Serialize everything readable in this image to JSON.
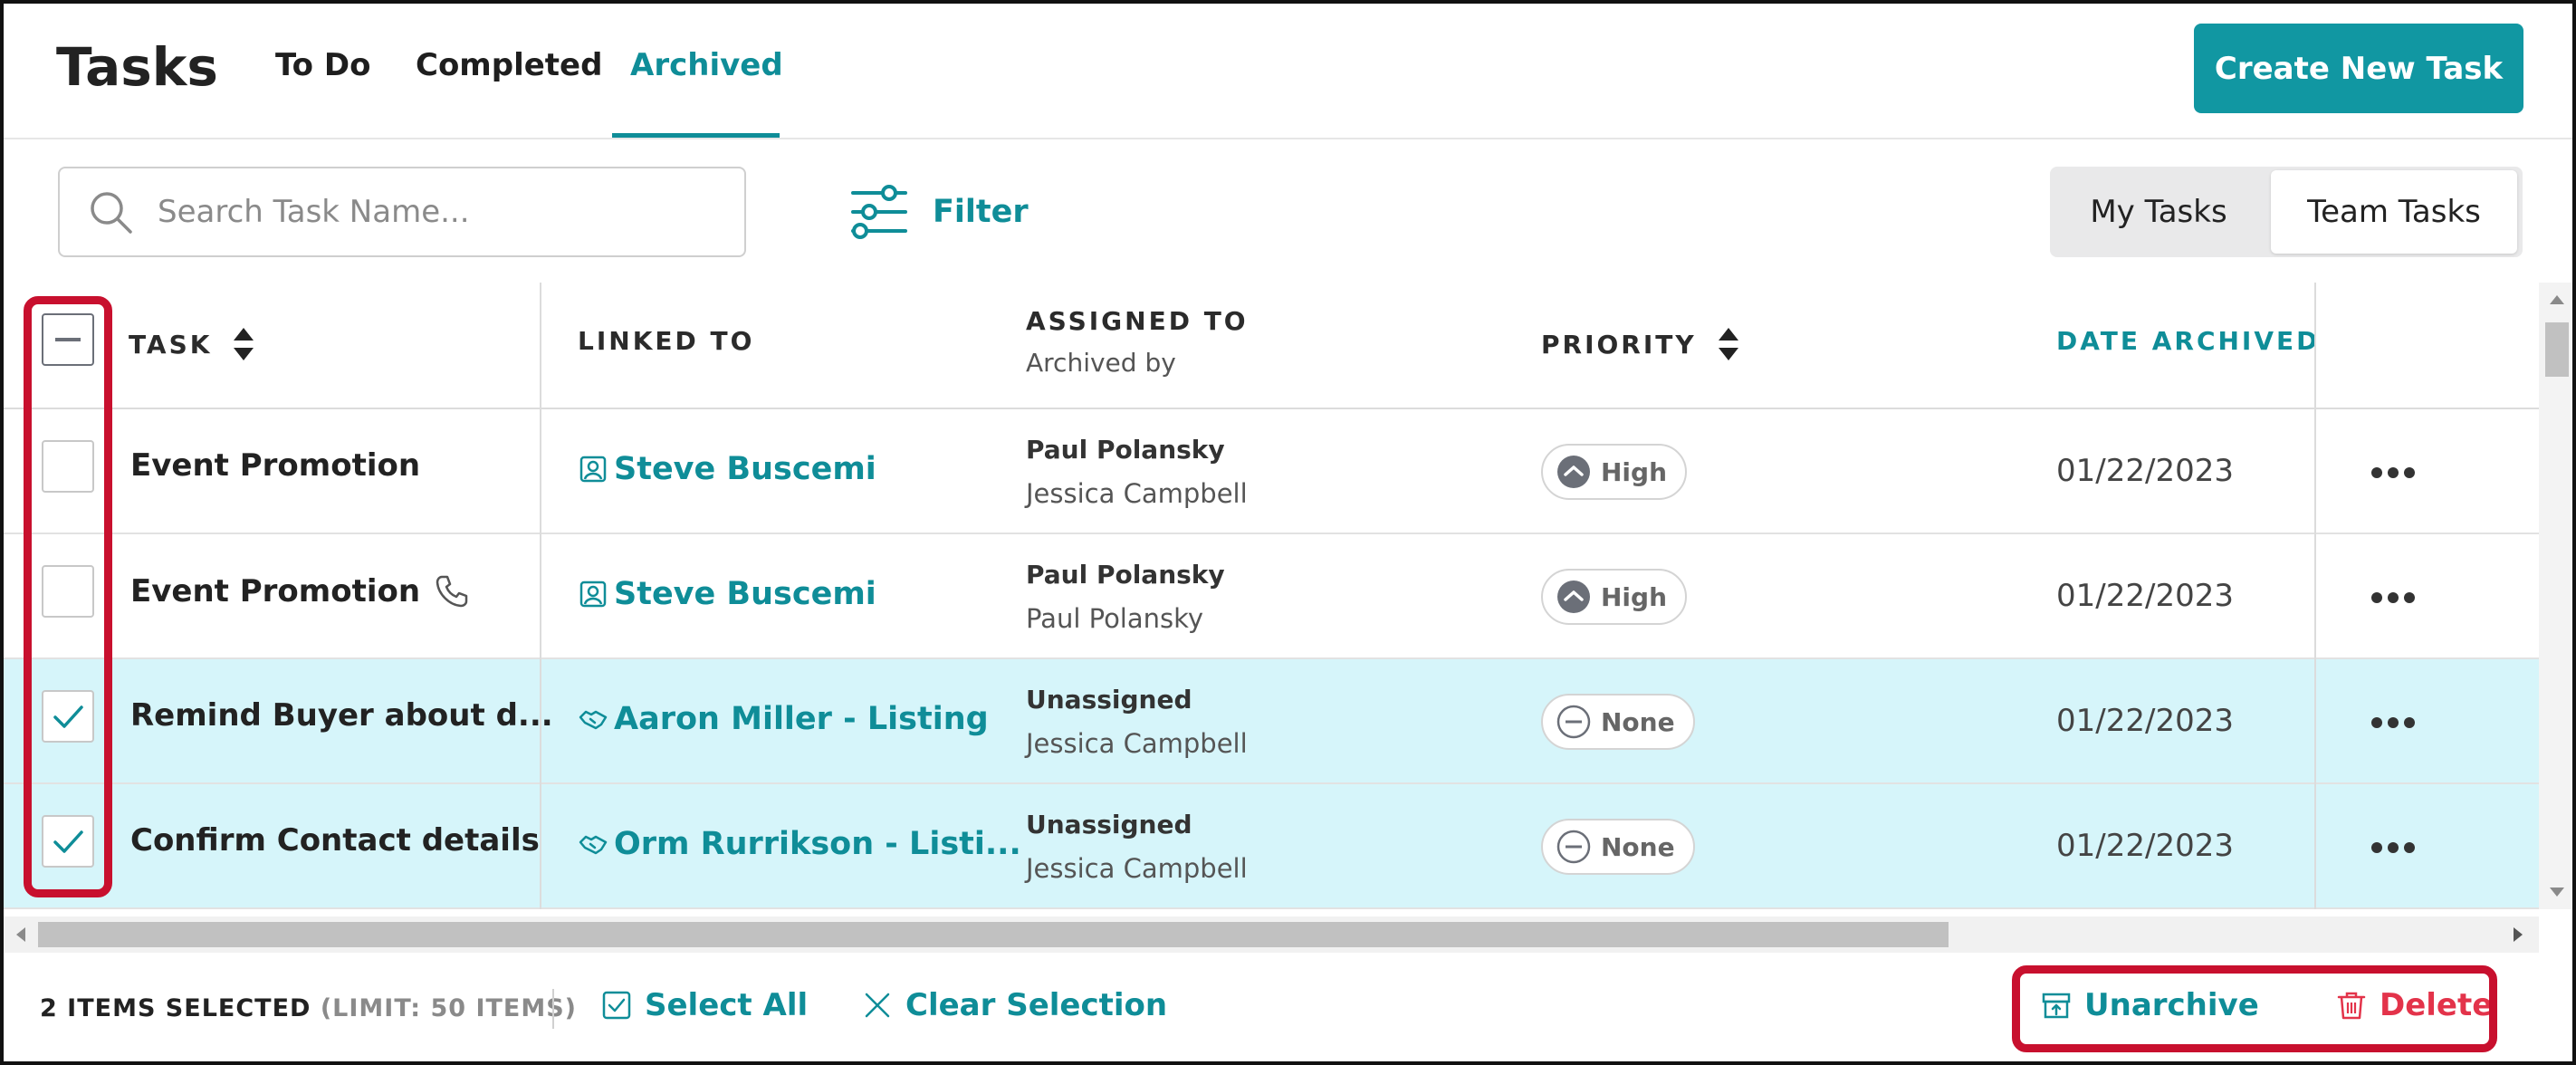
{
  "header": {
    "title": "Tasks",
    "tabs": [
      {
        "label": "To Do"
      },
      {
        "label": "Completed"
      },
      {
        "label": "Archived",
        "active": true
      }
    ],
    "create_button": "Create New Task"
  },
  "toolbar": {
    "search_placeholder": "Search Task Name...",
    "filter_label": "Filter",
    "scope_toggle": {
      "options": [
        "My Tasks",
        "Team Tasks"
      ],
      "selected": "Team Tasks"
    }
  },
  "table": {
    "columns": {
      "task": "TASK",
      "linked_to": "LINKED TO",
      "assigned_to": "ASSIGNED TO",
      "archived_by": "Archived by",
      "priority": "PRIORITY",
      "date_archived": "DATE ARCHIVED"
    },
    "rows": [
      {
        "checked": false,
        "task": "Event Promotion",
        "has_phone_icon": false,
        "linked_icon": "contact-icon",
        "linked_to": "Steve Buscemi",
        "assigned_to": "Paul Polansky",
        "archived_by": "Jessica Campbell",
        "priority": "High",
        "date_archived": "01/22/2023"
      },
      {
        "checked": false,
        "task": "Event Promotion",
        "has_phone_icon": true,
        "linked_icon": "contact-icon",
        "linked_to": "Steve Buscemi",
        "assigned_to": "Paul Polansky",
        "archived_by": "Paul Polansky",
        "priority": "High",
        "date_archived": "01/22/2023"
      },
      {
        "checked": true,
        "task": "Remind Buyer about d...",
        "has_phone_icon": false,
        "linked_icon": "handshake-icon",
        "linked_to": "Aaron Miller - Listing",
        "assigned_to": "Unassigned",
        "archived_by": "Jessica Campbell",
        "priority": "None",
        "date_archived": "01/22/2023"
      },
      {
        "checked": true,
        "task": "Confirm Contact details",
        "has_phone_icon": false,
        "linked_icon": "handshake-icon",
        "linked_to": "Orm Rurrikson - Listi...",
        "assigned_to": "Unassigned",
        "archived_by": "Jessica Campbell",
        "priority": "None",
        "date_archived": "01/22/2023"
      }
    ]
  },
  "footer": {
    "selected_count": "2 ITEMS SELECTED",
    "limit": "(LIMIT: 50 ITEMS)",
    "select_all": "Select All",
    "clear_selection": "Clear Selection",
    "unarchive": "Unarchive",
    "delete": "Delete"
  },
  "colors": {
    "accent": "#0f8d98",
    "selected_row": "#d6f5fa",
    "delete": "#e3334a",
    "highlight": "#c8102e"
  }
}
